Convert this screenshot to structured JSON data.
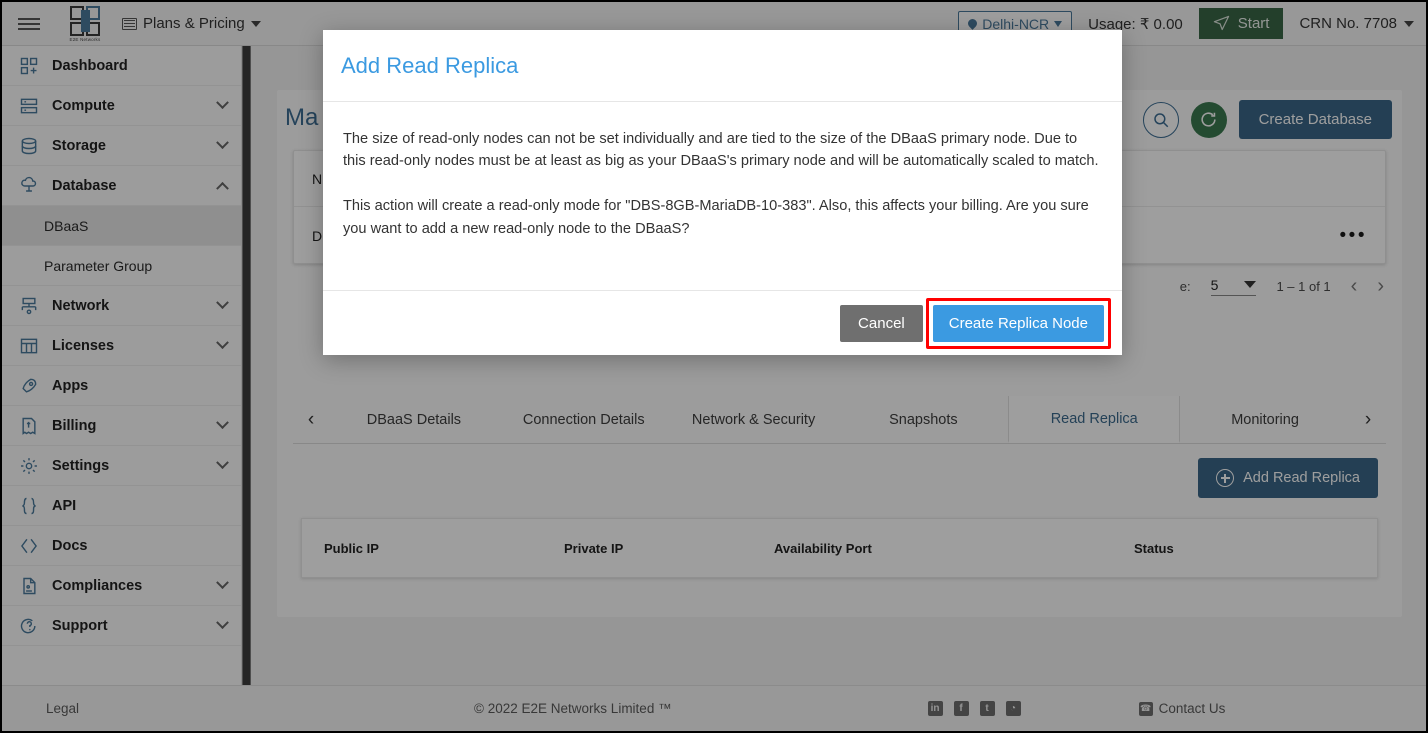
{
  "topbar": {
    "menu_icon": "hamburger-icon",
    "logo_caption": "E2E Networks",
    "plans_label": "Plans & Pricing",
    "region_label": "Delhi-NCR",
    "usage_label": "Usage: ₹ 0.00",
    "start_label": "Start",
    "crn_label": "CRN No. 7708"
  },
  "sidebar": {
    "items": [
      {
        "label": "Dashboard",
        "icon": "dashboard-icon",
        "expandable": false,
        "sub": false,
        "active": false
      },
      {
        "label": "Compute",
        "icon": "server-icon",
        "expandable": true,
        "sub": false,
        "active": false
      },
      {
        "label": "Storage",
        "icon": "database-stack-icon",
        "expandable": true,
        "sub": false,
        "active": false
      },
      {
        "label": "Database",
        "icon": "cloud-database-icon",
        "expandable": true,
        "expanded": true,
        "sub": false,
        "active": false
      },
      {
        "label": "DBaaS",
        "icon": "",
        "expandable": false,
        "sub": true,
        "active": true
      },
      {
        "label": "Parameter Group",
        "icon": "",
        "expandable": false,
        "sub": true,
        "active": false
      },
      {
        "label": "Network",
        "icon": "network-icon",
        "expandable": true,
        "sub": false,
        "active": false
      },
      {
        "label": "Licenses",
        "icon": "licenses-grid-icon",
        "expandable": true,
        "sub": false,
        "active": false
      },
      {
        "label": "Apps",
        "icon": "rocket-icon",
        "expandable": false,
        "sub": false,
        "active": false
      },
      {
        "label": "Billing",
        "icon": "billing-receipt-icon",
        "expandable": true,
        "sub": false,
        "active": false
      },
      {
        "label": "Settings",
        "icon": "gear-icon",
        "expandable": true,
        "sub": false,
        "active": false
      },
      {
        "label": "API",
        "icon": "braces-icon",
        "expandable": false,
        "sub": false,
        "active": false
      },
      {
        "label": "Docs",
        "icon": "angle-brackets-icon",
        "expandable": false,
        "sub": false,
        "active": false
      },
      {
        "label": "Compliances",
        "icon": "document-icon",
        "expandable": true,
        "sub": false,
        "active": false
      },
      {
        "label": "Support",
        "icon": "support-chat-icon",
        "expandable": true,
        "sub": false,
        "active": false
      }
    ]
  },
  "main": {
    "page_title": "Ma",
    "search_icon": "search-icon",
    "refresh_icon": "refresh-icon",
    "create_database_label": "Create Database",
    "card_row1_text": "N",
    "card_row2_text": "D",
    "overflow_menu": "•••",
    "paginator": {
      "per_page_label": "e:",
      "per_page_value": "5",
      "range_label": "1 – 1 of 1",
      "prev_icon": "chevron-left-icon",
      "next_icon": "chevron-right-icon"
    },
    "tabs": {
      "prev_arrow": "‹",
      "next_arrow": "›",
      "items": [
        {
          "label": "DBaaS Details",
          "active": false
        },
        {
          "label": "Connection Details",
          "active": false
        },
        {
          "label": "Network & Security",
          "active": false
        },
        {
          "label": "Snapshots",
          "active": false
        },
        {
          "label": "Read Replica",
          "active": true
        },
        {
          "label": "Monitoring",
          "active": false
        }
      ]
    },
    "read_replica_panel": {
      "add_button_label": "Add Read Replica",
      "add_button_icon": "plus-circle-icon",
      "table_headers": [
        "Public IP",
        "Private IP",
        "Availability Port",
        "Status"
      ],
      "rows": []
    }
  },
  "modal": {
    "title": "Add Read Replica",
    "paragraph1": "The size of read-only nodes can not be set individually and are tied to the size of the DBaaS primary node. Due to this read-only nodes must be at least as big as your DBaaS's primary node and will be automatically scaled to match.",
    "paragraph2": "This action will create a read-only mode for \"DBS-8GB-MariaDB-10-383\". Also, this affects your billing. Are you sure you want to add a new read-only node to the DBaaS?",
    "cancel_label": "Cancel",
    "create_label": "Create Replica Node",
    "highlight_color": "#ff0000"
  },
  "footer": {
    "legal": "Legal",
    "copyright": "© 2022 E2E Networks Limited ™",
    "social": [
      "in",
      "f",
      "t",
      "◔"
    ],
    "contact": "Contact Us"
  },
  "colors": {
    "accent_blue": "#1b6ca8",
    "title_blue": "#3b9ae1",
    "green": "#1e7033",
    "sidebar_icon": "#2b7fbd"
  }
}
